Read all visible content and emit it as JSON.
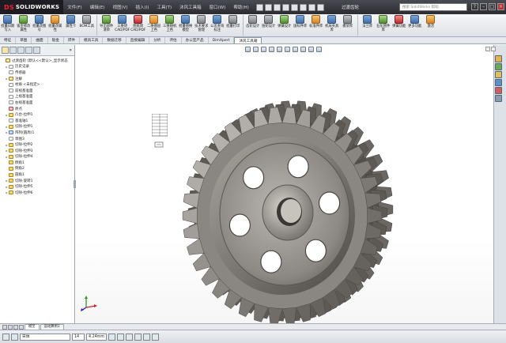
{
  "app": {
    "logo": "SOLIDWORKS",
    "ds": "DS",
    "title": "过渡齿轮",
    "search_placeholder": "搜索 SolidWorks 帮助"
  },
  "menu": [
    "文件(F)",
    "编辑(E)",
    "视图(V)",
    "插入(I)",
    "工具(T)",
    "沐风工具箱",
    "窗口(W)",
    "帮助(H)"
  ],
  "toolbar": [
    {
      "label": "批量日期写入",
      "color": "b"
    },
    {
      "label": "钣金修改属性",
      "color": "g"
    },
    {
      "label": "批量改图号",
      "color": "b"
    },
    {
      "label": "批量改属性",
      "color": "o"
    },
    {
      "label": "属性卡",
      "color": "b"
    },
    {
      "label": "BOM工具",
      "color": "k"
    },
    {
      "label": "导出部件清单",
      "color": "g"
    },
    {
      "label": "三维转CAD/PDF",
      "color": "b"
    },
    {
      "label": "图纸转CAD/PDF",
      "color": "r"
    },
    {
      "label": "二维图层上色",
      "color": "o"
    },
    {
      "label": "三维随机上色",
      "color": "g"
    },
    {
      "label": "批量替换模型",
      "color": "b"
    },
    {
      "label": "技术要求管理",
      "color": "k"
    },
    {
      "label": "公差查询标注",
      "color": "b"
    },
    {
      "label": "批量打印",
      "color": "k"
    },
    {
      "label": "齿轮设计",
      "color": "k"
    },
    {
      "label": "链轮设计",
      "color": "k"
    },
    {
      "label": "弹簧设计",
      "color": "g"
    },
    {
      "label": "国标件库",
      "color": "b"
    },
    {
      "label": "标准件库",
      "color": "o"
    },
    {
      "label": "机床夹具库",
      "color": "b"
    },
    {
      "label": "模架库",
      "color": "k"
    },
    {
      "label": "法兰库",
      "color": "b"
    },
    {
      "label": "石化管件库",
      "color": "g"
    },
    {
      "label": "弹簧功能",
      "color": "r"
    },
    {
      "label": "更多功能",
      "color": "b"
    },
    {
      "label": "激活",
      "color": "o"
    }
  ],
  "tabs": [
    {
      "label": "特征",
      "active": false
    },
    {
      "label": "草图",
      "active": false
    },
    {
      "label": "曲面",
      "active": false
    },
    {
      "label": "钣金",
      "active": false
    },
    {
      "label": "焊件",
      "active": false
    },
    {
      "label": "模具工具",
      "active": false
    },
    {
      "label": "数据迁移",
      "active": false
    },
    {
      "label": "直接编辑",
      "active": false
    },
    {
      "label": "分析",
      "active": false
    },
    {
      "label": "评估",
      "active": false
    },
    {
      "label": "办公室产品",
      "active": false
    },
    {
      "label": "DimXpert",
      "active": false
    },
    {
      "label": "沐风工具箱",
      "active": true
    }
  ],
  "tree": [
    {
      "label": "过渡齿轮 (默认<<默认>_显示状态",
      "icon": "a",
      "indent": 0,
      "expand": ""
    },
    {
      "label": "历史记录",
      "icon": "p",
      "indent": 1,
      "expand": "▸"
    },
    {
      "label": "传感器",
      "icon": "p",
      "indent": 1,
      "expand": ""
    },
    {
      "label": "注解",
      "icon": "a",
      "indent": 1,
      "expand": "▸"
    },
    {
      "label": "材质 <未指定>",
      "icon": "p",
      "indent": 1,
      "expand": ""
    },
    {
      "label": "前视基准面",
      "icon": "p",
      "indent": 1,
      "expand": ""
    },
    {
      "label": "上视基准面",
      "icon": "p",
      "indent": 1,
      "expand": ""
    },
    {
      "label": "右视基准面",
      "icon": "p",
      "indent": 1,
      "expand": ""
    },
    {
      "label": "原点",
      "icon": "w",
      "indent": 1,
      "expand": ""
    },
    {
      "label": "凸台-拉伸1",
      "icon": "f",
      "indent": 1,
      "expand": "▸"
    },
    {
      "label": "基准轴1",
      "icon": "p",
      "indent": 1,
      "expand": ""
    },
    {
      "label": "切除-拉伸1",
      "icon": "f",
      "indent": 1,
      "expand": "▸"
    },
    {
      "label": "阵列(圆周)1",
      "icon": "c",
      "indent": 1,
      "expand": "▸"
    },
    {
      "label": "草图3",
      "icon": "p",
      "indent": 1,
      "expand": ""
    },
    {
      "label": "切除-拉伸2",
      "icon": "f",
      "indent": 1,
      "expand": "▸"
    },
    {
      "label": "切除-拉伸3",
      "icon": "f",
      "indent": 1,
      "expand": "▸"
    },
    {
      "label": "切除-拉伸4",
      "icon": "f",
      "indent": 1,
      "expand": "▸"
    },
    {
      "label": "倒角1",
      "icon": "f",
      "indent": 1,
      "expand": ""
    },
    {
      "label": "倒角2",
      "icon": "f",
      "indent": 1,
      "expand": ""
    },
    {
      "label": "圆角1",
      "icon": "f",
      "indent": 1,
      "expand": ""
    },
    {
      "label": "切除-旋转1",
      "icon": "f",
      "indent": 1,
      "expand": "▸"
    },
    {
      "label": "切除-拉伸5",
      "icon": "f",
      "indent": 1,
      "expand": "▸"
    },
    {
      "label": "切除-拉伸6",
      "icon": "f",
      "indent": 1,
      "expand": "▸"
    }
  ],
  "bottom_tabs": [
    {
      "label": "模型",
      "active": true
    },
    {
      "label": "运动算例1",
      "active": false
    }
  ],
  "status": {
    "font": "宋体",
    "size": "14",
    "value": "4.24mm"
  },
  "colors": {
    "titlebar": "#2b2b31",
    "gear": "#7a7570",
    "accent": "#3d6ea8"
  },
  "gear": {
    "teeth": 38
  }
}
